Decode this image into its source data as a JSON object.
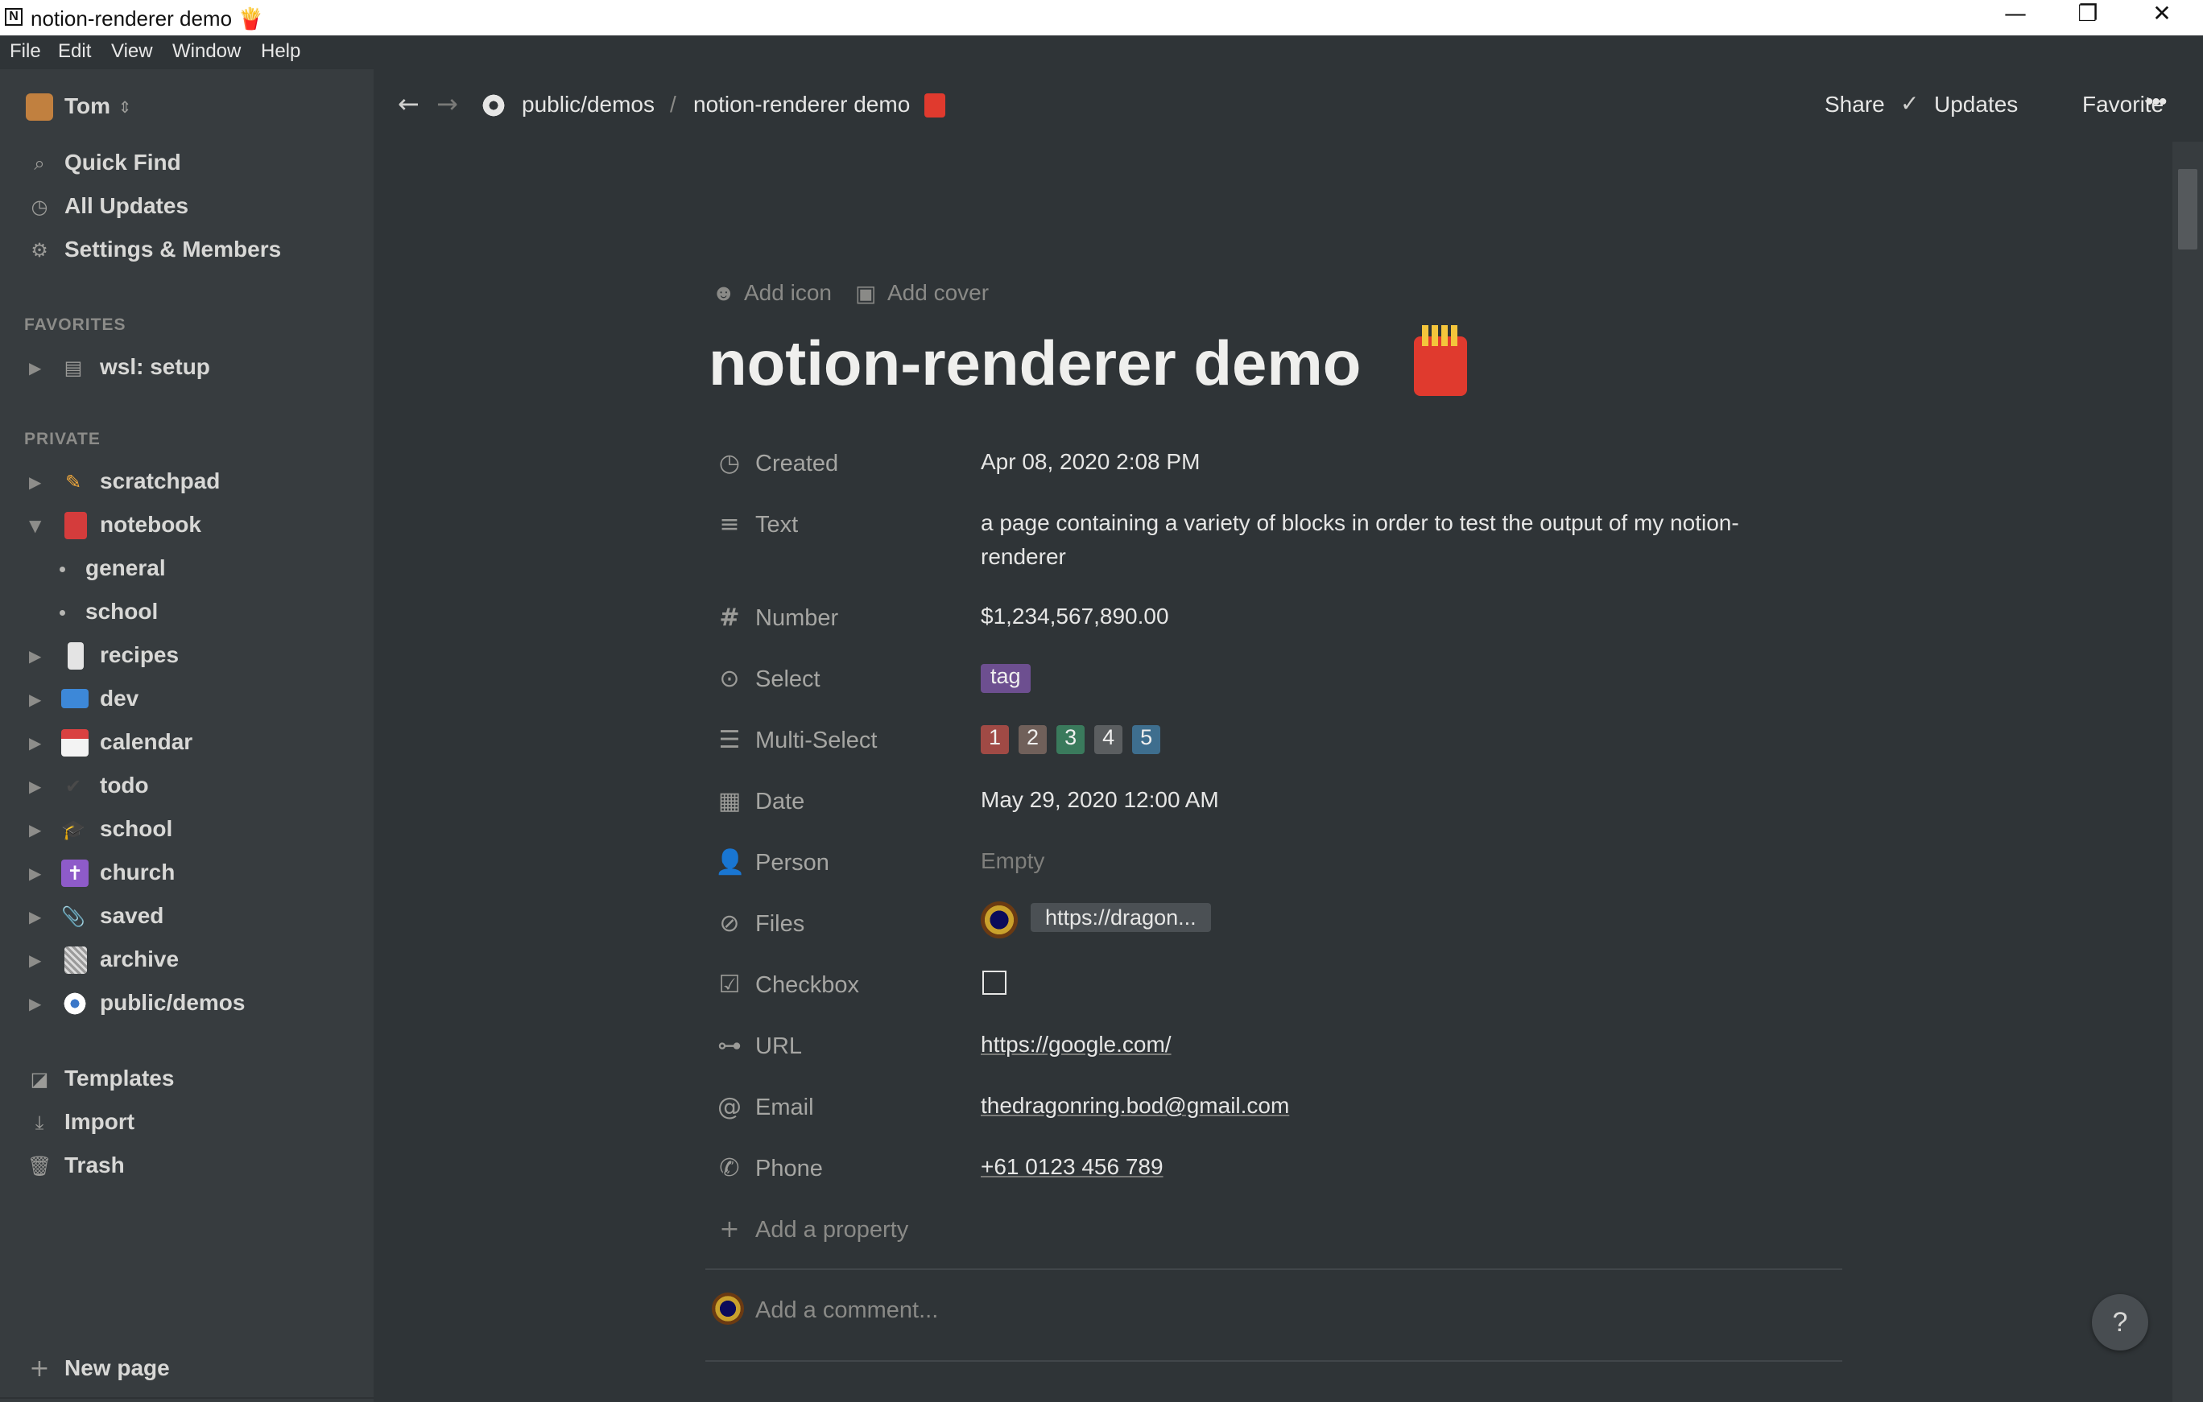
{
  "window": {
    "title": "notion-renderer demo 🍟",
    "app_icon": "N",
    "controls": {
      "minimize": "—",
      "restore": "❐",
      "close": "✕"
    }
  },
  "menu": [
    "File",
    "Edit",
    "View",
    "Window",
    "Help"
  ],
  "sidebar": {
    "workspace": "Tom",
    "workspace_switch_icon": "⇕",
    "nav": [
      {
        "label": "Quick Find",
        "icon": "search-icon"
      },
      {
        "label": "All Updates",
        "icon": "clock-icon"
      },
      {
        "label": "Settings & Members",
        "icon": "gear-icon"
      }
    ],
    "favorites_heading": "FAVORITES",
    "favorites": [
      {
        "label": "wsl: setup",
        "icon": "page-icon"
      }
    ],
    "private_heading": "PRIVATE",
    "private": [
      {
        "label": "scratchpad",
        "emoji": "✏️",
        "expanded": false
      },
      {
        "label": "notebook",
        "emoji": "📕",
        "expanded": true
      },
      {
        "label": "general",
        "child": true
      },
      {
        "label": "school",
        "child": true
      },
      {
        "label": "recipes",
        "emoji": "🧂",
        "expanded": false
      },
      {
        "label": "dev",
        "emoji": "💻",
        "expanded": false
      },
      {
        "label": "calendar",
        "emoji": "📅",
        "expanded": false
      },
      {
        "label": "todo",
        "emoji": "✔️",
        "expanded": false
      },
      {
        "label": "school",
        "emoji": "🎓",
        "expanded": false
      },
      {
        "label": "church",
        "emoji": "✝️",
        "expanded": false
      },
      {
        "label": "saved",
        "emoji": "📎",
        "expanded": false
      },
      {
        "label": "archive",
        "emoji": "🗑️",
        "expanded": false
      },
      {
        "label": "public/demos",
        "emoji": "👁️",
        "expanded": false
      }
    ],
    "bottom": [
      {
        "label": "Templates",
        "icon": "templates-icon"
      },
      {
        "label": "Import",
        "icon": "import-icon"
      },
      {
        "label": "Trash",
        "icon": "trash-icon"
      }
    ],
    "new_page": "New page"
  },
  "topbar": {
    "breadcrumb_parent": "public/demos",
    "breadcrumb_sep": "/",
    "breadcrumb_current": "notion-renderer demo",
    "share": "Share",
    "updates": "Updates",
    "favorite": "Favorite",
    "more": "•••"
  },
  "page": {
    "add_icon": "Add icon",
    "add_cover": "Add cover",
    "title": "notion-renderer demo",
    "title_emoji": "🍟",
    "properties": [
      {
        "name": "Created",
        "icon": "clock-icon",
        "value": "Apr 08, 2020 2:08 PM"
      },
      {
        "name": "Text",
        "icon": "text-lines-icon",
        "value": "a page containing a variety of blocks in order to test the output of my notion-",
        "value2": "renderer"
      },
      {
        "name": "Number",
        "icon": "hash-icon",
        "value": "$1,234,567,890.00"
      },
      {
        "name": "Select",
        "icon": "select-icon",
        "tag": "tag",
        "tag_color": "#6d4f90"
      },
      {
        "name": "Multi-Select",
        "icon": "list-icon",
        "tags": [
          {
            "label": "1",
            "color": "#a04a45"
          },
          {
            "label": "2",
            "color": "#70605a"
          },
          {
            "label": "3",
            "color": "#3a7a5c"
          },
          {
            "label": "4",
            "color": "#5b5e60"
          },
          {
            "label": "5",
            "color": "#3e6e8e"
          }
        ]
      },
      {
        "name": "Date",
        "icon": "calendar-icon",
        "value": "May 29, 2020 12:00 AM"
      },
      {
        "name": "Person",
        "icon": "person-icon",
        "value": "Empty"
      },
      {
        "name": "Files",
        "icon": "paperclip-icon",
        "value": "https://dragon..."
      },
      {
        "name": "Checkbox",
        "icon": "checkbox-icon",
        "checked": false
      },
      {
        "name": "URL",
        "icon": "link-icon",
        "value": "https://google.com/"
      },
      {
        "name": "Email",
        "icon": "at-icon",
        "value": "thedragonring.bod@gmail.com"
      },
      {
        "name": "Phone",
        "icon": "phone-icon",
        "value": "+61 0123 456 789"
      }
    ],
    "add_property": "Add a property",
    "add_comment": "Add a comment..."
  },
  "help": "?"
}
